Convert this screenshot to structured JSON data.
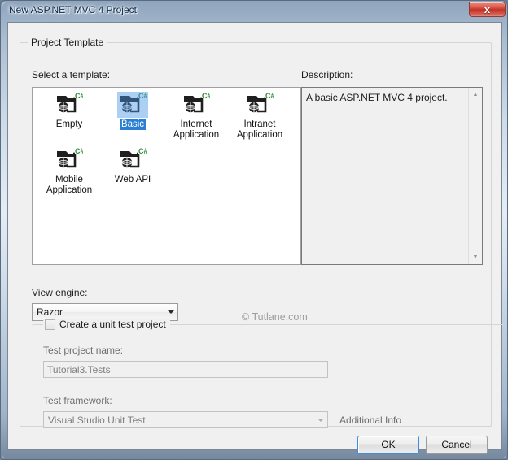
{
  "window": {
    "title": "New ASP.NET MVC 4 Project",
    "close_label": "x",
    "close_icon": "close-icon"
  },
  "project_template_group": {
    "legend": "Project Template",
    "select_template_label": "Select a template:",
    "description_label": "Description:",
    "description_text": "A basic ASP.NET MVC 4 project.",
    "templates": [
      {
        "label": "Empty",
        "selected": false,
        "icon": "csharp-web-project-icon"
      },
      {
        "label": "Basic",
        "selected": true,
        "icon": "csharp-web-project-icon"
      },
      {
        "label": "Internet Application",
        "selected": false,
        "icon": "csharp-web-project-icon"
      },
      {
        "label": "Intranet Application",
        "selected": false,
        "icon": "csharp-web-project-icon"
      },
      {
        "label": "Mobile Application",
        "selected": false,
        "icon": "csharp-web-project-icon"
      },
      {
        "label": "Web API",
        "selected": false,
        "icon": "csharp-web-project-icon"
      }
    ],
    "view_engine_label": "View engine:",
    "view_engine_value": "Razor",
    "scroll_up_icon": "scroll-up-arrow-icon",
    "scroll_down_icon": "scroll-down-arrow-icon"
  },
  "unit_test_group": {
    "checkbox_label": "Create a unit test project",
    "checkbox_checked": false,
    "test_project_name_label": "Test project name:",
    "test_project_name_value": "Tutorial3.Tests",
    "test_framework_label": "Test framework:",
    "test_framework_value": "Visual Studio Unit Test",
    "additional_info_label": "Additional Info"
  },
  "footer": {
    "ok_label": "OK",
    "cancel_label": "Cancel"
  },
  "watermark": "© Tutlane.com",
  "colors": {
    "selection_blue": "#2a7fd4",
    "csharp_green": "#2e8b36",
    "icon_dark": "#1f1f1f",
    "close_red": "#c83a2c"
  }
}
